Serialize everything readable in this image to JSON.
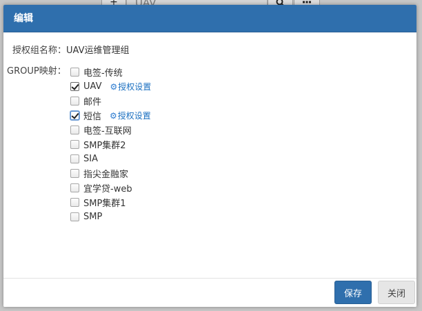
{
  "background": {
    "add_button": "+",
    "search_value": "UAV",
    "search_icon": "search-icon",
    "grid_icon": "grid-icon"
  },
  "modal": {
    "title": "编辑",
    "name_label": "授权组名称：",
    "name_value": "UAV运维管理组",
    "group_label": "GROUP映射：",
    "auth_link_label": "授权设置",
    "items": [
      {
        "label": "电签-传统",
        "checked": false,
        "has_auth": false
      },
      {
        "label": "UAV",
        "checked": true,
        "has_auth": true
      },
      {
        "label": "邮件",
        "checked": false,
        "has_auth": false
      },
      {
        "label": "短信",
        "checked": true,
        "has_auth": true
      },
      {
        "label": "电签-互联网",
        "checked": false,
        "has_auth": false
      },
      {
        "label": "SMP集群2",
        "checked": false,
        "has_auth": false
      },
      {
        "label": "SIA",
        "checked": false,
        "has_auth": false
      },
      {
        "label": "指尖金融家",
        "checked": false,
        "has_auth": false
      },
      {
        "label": "宜学贷-web",
        "checked": false,
        "has_auth": false
      },
      {
        "label": "SMP集群1",
        "checked": false,
        "has_auth": false
      },
      {
        "label": "SMP",
        "checked": false,
        "has_auth": false
      }
    ],
    "save_label": "保存",
    "close_label": "关闭"
  },
  "colors": {
    "header": "#2f6fad",
    "primary_button": "#2f6fad",
    "link": "#1a6fc0"
  }
}
